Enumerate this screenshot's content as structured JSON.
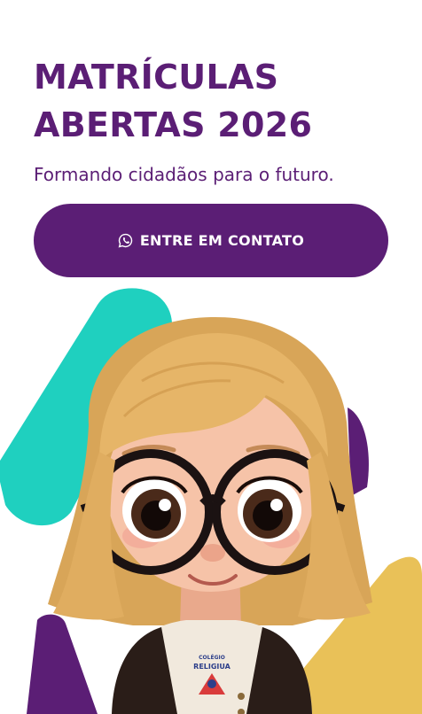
{
  "hero": {
    "title_line1": "MATRÍCULAS",
    "title_line2": "ABERTAS 2026",
    "subtitle": "Formando cidadãos para o futuro."
  },
  "cta": {
    "label": "ENTRE EM CONTATO",
    "icon": "whatsapp-icon"
  },
  "illustration": {
    "shirt_logo_top": "COLÉGIO",
    "shirt_logo_main": "RELIGIUA"
  },
  "colors": {
    "brand_purple": "#5b1e75",
    "teal_shape": "#1fd0bf",
    "yellow_shape": "#e9c158",
    "background": "#ffffff"
  }
}
